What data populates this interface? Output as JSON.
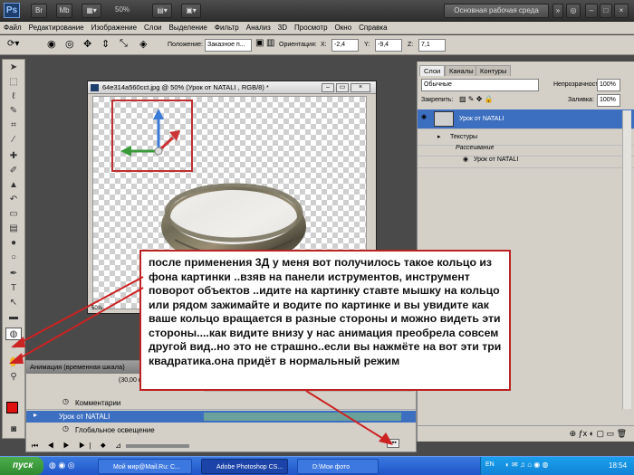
{
  "title_bar": {
    "app_logo": "Ps",
    "btn_mb": "Mb",
    "zoom": "50%",
    "workspace_button": "Основная рабочая среда"
  },
  "menu": [
    "Файл",
    "Редактирование",
    "Изображение",
    "Слои",
    "Выделение",
    "Фильтр",
    "Анализ",
    "3D",
    "Просмотр",
    "Окно",
    "Справка"
  ],
  "options": {
    "position_label": "Положение:",
    "position_value": "Заказное п...",
    "orientation_label": "Ориентация:",
    "x_label": "X:",
    "x_value": "-2,4",
    "y_label": "Y:",
    "y_value": "-9,4",
    "z_label": "Z:",
    "z_value": "7,1"
  },
  "document": {
    "title": "64e314a560cct.jpg @ 50% (Урок от  NATALI , RGB/8) *",
    "zoom": "50%"
  },
  "layers_panel": {
    "tabs": [
      "Слои",
      "Каналы",
      "Контуры"
    ],
    "blend_mode": "Обычные",
    "opacity_label": "Непрозрачность:",
    "opacity_value": "100%",
    "lock_label": "Закрепить:",
    "fill_label": "Заливка:",
    "fill_value": "100%",
    "layer_name": "Урок от  NATALI",
    "textures_label": "Текстуры",
    "diffuse_label": "Рассеивание",
    "texture_item": "Урок от  NATALI"
  },
  "animation_panel": {
    "title": "Анимация (временная шкала)",
    "time": "(30,00 к",
    "rows": [
      "Комментарии",
      "Урок от  NATALI",
      "Глобальное освещение"
    ]
  },
  "callout_text": "после применения 3Д у меня вот получилось такое кольцо из фона картинки ..взяв  на панели иструментов, инструмент поворот объектов ..идите на картинку  ставте мышку на кольцо или рядом зажимайте и водите по картинке и вы увидите как ваше кольцо вращается в разные стороны и можно видеть эти стороны....как видите внизу у нас анимация преобрела совсем другой вид..но это не страшно..если вы нажмёте на вот эти три квадратика.она придёт в нормальный режим",
  "taskbar": {
    "start": "пуск",
    "tasks": [
      "Мой мир@Mail.Ru: С...",
      "Adobe Photoshop CS...",
      "D:\\Мои фото"
    ],
    "lang": "EN",
    "clock": "18:54"
  },
  "colors": {
    "accent_red": "#cc2222",
    "selected_layer": "#3d6fc0",
    "taskbar": "#1f54c8",
    "start": "#3c9a3c"
  }
}
